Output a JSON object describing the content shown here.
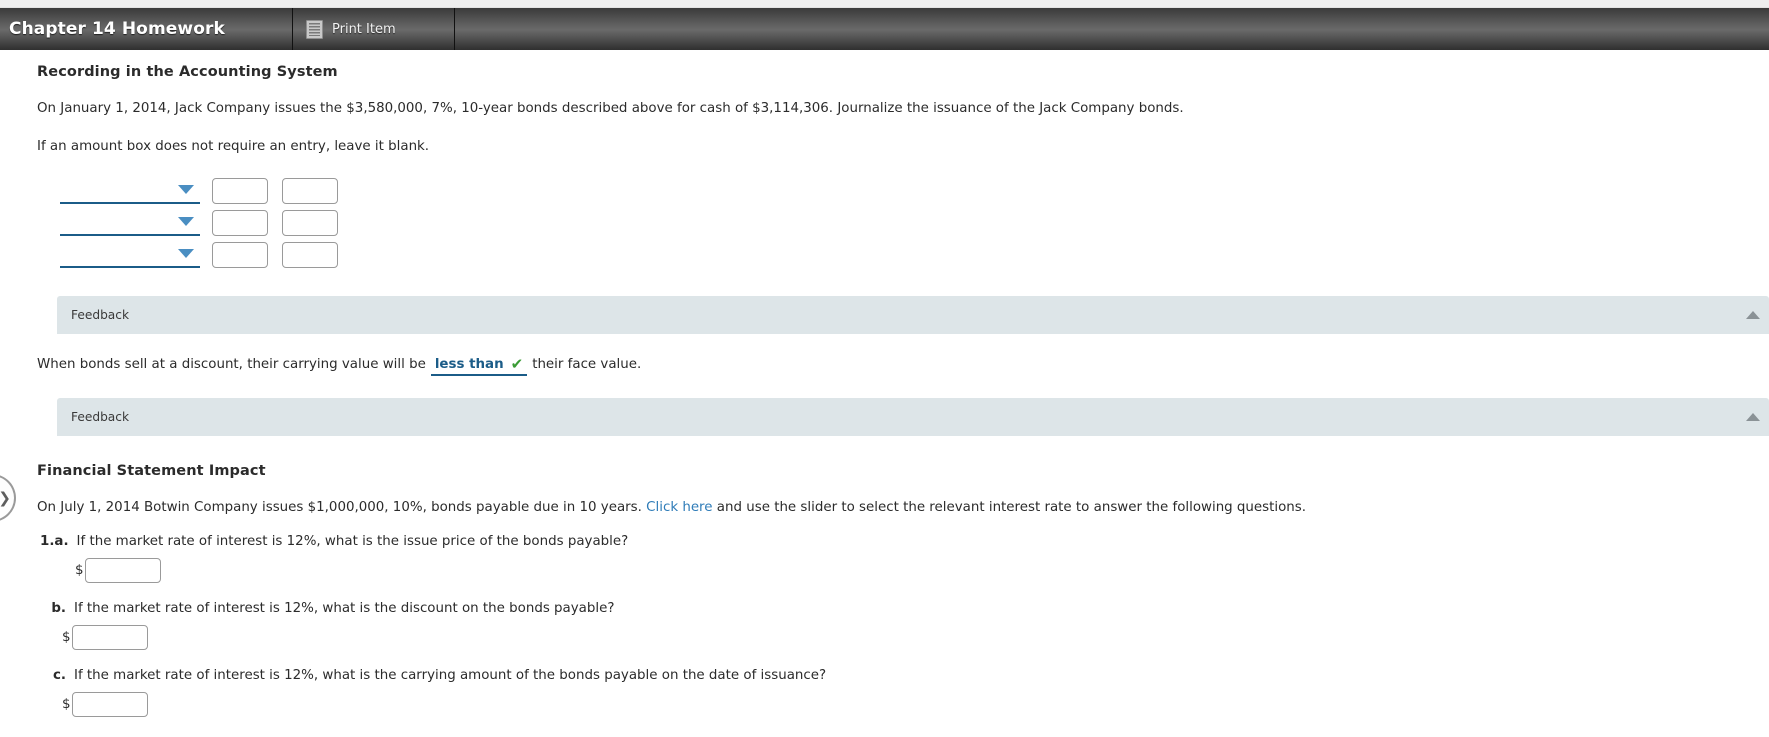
{
  "header": {
    "title": "Chapter 14 Homework",
    "print_label": "Print Item",
    "print_icon": "print-item-icon"
  },
  "recording_section": {
    "title": "Recording in the Accounting System",
    "intro": "On January 1, 2014, Jack Company issues the $3,580,000, 7%, 10-year bonds described above for cash of $3,114,306. Journalize the issuance of the Jack Company bonds.",
    "instruction": "If an amount box does not require an entry, leave it blank.",
    "journal_rows": [
      {
        "account_value": "",
        "account_placeholder": "",
        "debit": "",
        "credit": ""
      },
      {
        "account_value": "",
        "account_placeholder": "",
        "debit": "",
        "credit": ""
      },
      {
        "account_value": "",
        "account_placeholder": "",
        "debit": "",
        "credit": ""
      }
    ],
    "feedback_label": "Feedback"
  },
  "discount_sentence": {
    "prefix": "When bonds sell at a discount, their carrying value will be",
    "answer": "less than",
    "check": "✔",
    "suffix": "their face value.",
    "feedback_label": "Feedback"
  },
  "impact_section": {
    "title": "Financial Statement Impact",
    "intro_before_link": "On July 1, 2014 Botwin Company issues $1,000,000, 10%, bonds payable due in 10 years.",
    "link_text": "Click here",
    "intro_after_link": "and use the slider to select the relevant interest rate to answer the following questions.",
    "questions": [
      {
        "number": "1.a.",
        "text": "If the market rate of interest is 12%, what is the issue price of the bonds payable?",
        "currency_symbol": "$",
        "value": "",
        "has_input": true
      },
      {
        "number": "b.",
        "text": "If the market rate of interest is 12%, what is the discount on the bonds payable?",
        "currency_symbol": "$",
        "value": "",
        "has_input": true
      },
      {
        "number": "c.",
        "text": "If the market rate of interest is 12%, what is the carrying amount of the bonds payable on the date of issuance?",
        "currency_symbol": "$",
        "value": "",
        "has_input": true
      }
    ]
  },
  "side_pager": {
    "icon": "chevron-right-icon",
    "glyph": "❯"
  },
  "colors": {
    "header_dark": "#4a4a4a",
    "accent_blue": "#1b5c88",
    "caret_blue": "#4a8ec2",
    "link_blue": "#2f7cb8",
    "check_green": "#3a9b35",
    "feedback_bg": "#dde5e8"
  }
}
